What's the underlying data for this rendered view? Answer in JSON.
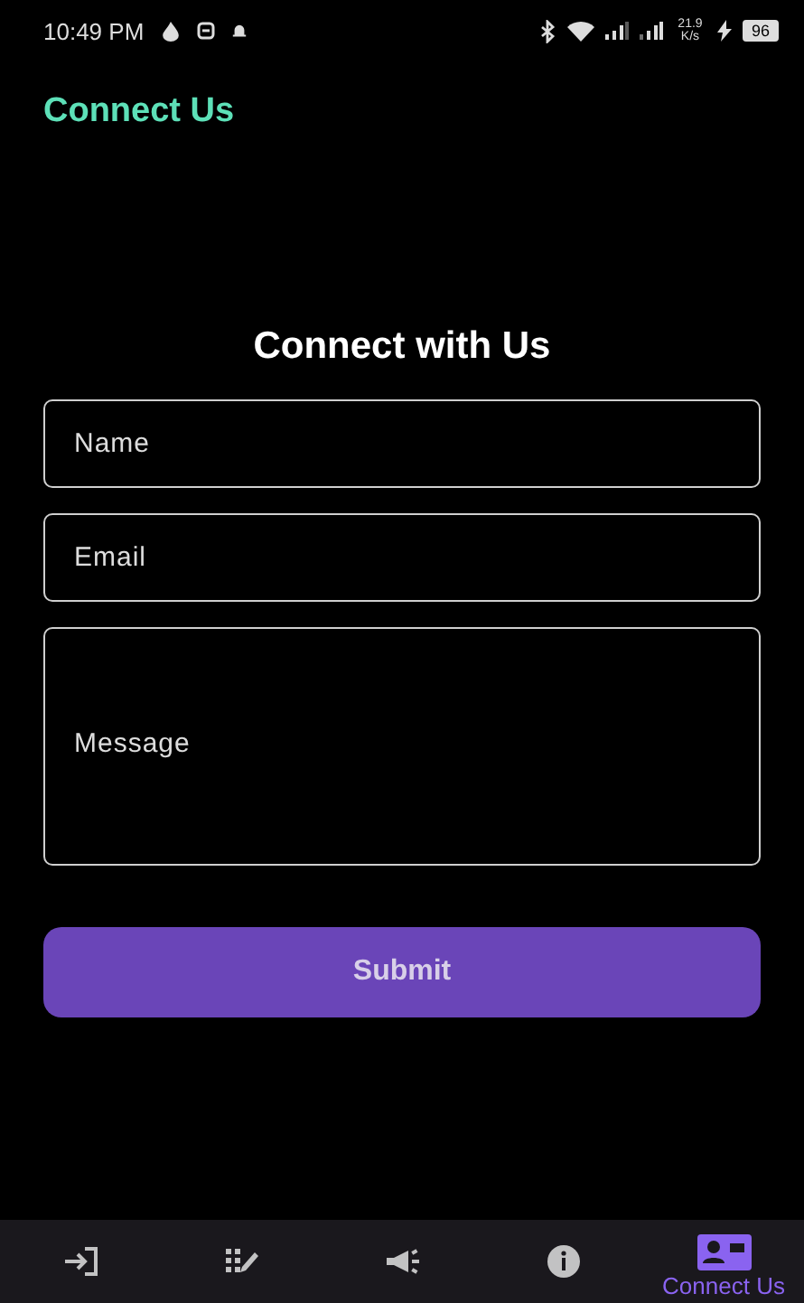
{
  "status_bar": {
    "time": "10:49 PM",
    "net_speed": "21.9 K/s",
    "battery": "96"
  },
  "app_bar": {
    "title": "Connect Us"
  },
  "form": {
    "heading": "Connect with Us",
    "fields": [
      {
        "placeholder": "Name",
        "kind": "line"
      },
      {
        "placeholder": "Email",
        "kind": "line"
      },
      {
        "placeholder": "Message",
        "kind": "area"
      }
    ],
    "submit": "Submit"
  },
  "bottom_nav": [
    {
      "kind": "login",
      "selected": false
    },
    {
      "kind": "grid",
      "selected": false
    },
    {
      "kind": "megaphone",
      "selected": false
    },
    {
      "kind": "info",
      "selected": false
    },
    {
      "kind": "contact",
      "selected": true,
      "label": "Connect Us"
    }
  ]
}
